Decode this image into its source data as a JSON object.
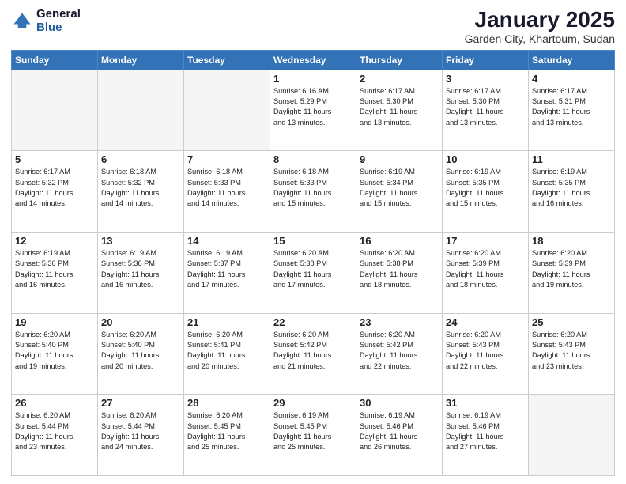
{
  "header": {
    "title": "January 2025",
    "subtitle": "Garden City, Khartoum, Sudan",
    "logo_general": "General",
    "logo_blue": "Blue"
  },
  "days_of_week": [
    "Sunday",
    "Monday",
    "Tuesday",
    "Wednesday",
    "Thursday",
    "Friday",
    "Saturday"
  ],
  "weeks": [
    [
      {
        "day": "",
        "info": ""
      },
      {
        "day": "",
        "info": ""
      },
      {
        "day": "",
        "info": ""
      },
      {
        "day": "1",
        "info": "Sunrise: 6:16 AM\nSunset: 5:29 PM\nDaylight: 11 hours\nand 13 minutes."
      },
      {
        "day": "2",
        "info": "Sunrise: 6:17 AM\nSunset: 5:30 PM\nDaylight: 11 hours\nand 13 minutes."
      },
      {
        "day": "3",
        "info": "Sunrise: 6:17 AM\nSunset: 5:30 PM\nDaylight: 11 hours\nand 13 minutes."
      },
      {
        "day": "4",
        "info": "Sunrise: 6:17 AM\nSunset: 5:31 PM\nDaylight: 11 hours\nand 13 minutes."
      }
    ],
    [
      {
        "day": "5",
        "info": "Sunrise: 6:17 AM\nSunset: 5:32 PM\nDaylight: 11 hours\nand 14 minutes."
      },
      {
        "day": "6",
        "info": "Sunrise: 6:18 AM\nSunset: 5:32 PM\nDaylight: 11 hours\nand 14 minutes."
      },
      {
        "day": "7",
        "info": "Sunrise: 6:18 AM\nSunset: 5:33 PM\nDaylight: 11 hours\nand 14 minutes."
      },
      {
        "day": "8",
        "info": "Sunrise: 6:18 AM\nSunset: 5:33 PM\nDaylight: 11 hours\nand 15 minutes."
      },
      {
        "day": "9",
        "info": "Sunrise: 6:19 AM\nSunset: 5:34 PM\nDaylight: 11 hours\nand 15 minutes."
      },
      {
        "day": "10",
        "info": "Sunrise: 6:19 AM\nSunset: 5:35 PM\nDaylight: 11 hours\nand 15 minutes."
      },
      {
        "day": "11",
        "info": "Sunrise: 6:19 AM\nSunset: 5:35 PM\nDaylight: 11 hours\nand 16 minutes."
      }
    ],
    [
      {
        "day": "12",
        "info": "Sunrise: 6:19 AM\nSunset: 5:36 PM\nDaylight: 11 hours\nand 16 minutes."
      },
      {
        "day": "13",
        "info": "Sunrise: 6:19 AM\nSunset: 5:36 PM\nDaylight: 11 hours\nand 16 minutes."
      },
      {
        "day": "14",
        "info": "Sunrise: 6:19 AM\nSunset: 5:37 PM\nDaylight: 11 hours\nand 17 minutes."
      },
      {
        "day": "15",
        "info": "Sunrise: 6:20 AM\nSunset: 5:38 PM\nDaylight: 11 hours\nand 17 minutes."
      },
      {
        "day": "16",
        "info": "Sunrise: 6:20 AM\nSunset: 5:38 PM\nDaylight: 11 hours\nand 18 minutes."
      },
      {
        "day": "17",
        "info": "Sunrise: 6:20 AM\nSunset: 5:39 PM\nDaylight: 11 hours\nand 18 minutes."
      },
      {
        "day": "18",
        "info": "Sunrise: 6:20 AM\nSunset: 5:39 PM\nDaylight: 11 hours\nand 19 minutes."
      }
    ],
    [
      {
        "day": "19",
        "info": "Sunrise: 6:20 AM\nSunset: 5:40 PM\nDaylight: 11 hours\nand 19 minutes."
      },
      {
        "day": "20",
        "info": "Sunrise: 6:20 AM\nSunset: 5:40 PM\nDaylight: 11 hours\nand 20 minutes."
      },
      {
        "day": "21",
        "info": "Sunrise: 6:20 AM\nSunset: 5:41 PM\nDaylight: 11 hours\nand 20 minutes."
      },
      {
        "day": "22",
        "info": "Sunrise: 6:20 AM\nSunset: 5:42 PM\nDaylight: 11 hours\nand 21 minutes."
      },
      {
        "day": "23",
        "info": "Sunrise: 6:20 AM\nSunset: 5:42 PM\nDaylight: 11 hours\nand 22 minutes."
      },
      {
        "day": "24",
        "info": "Sunrise: 6:20 AM\nSunset: 5:43 PM\nDaylight: 11 hours\nand 22 minutes."
      },
      {
        "day": "25",
        "info": "Sunrise: 6:20 AM\nSunset: 5:43 PM\nDaylight: 11 hours\nand 23 minutes."
      }
    ],
    [
      {
        "day": "26",
        "info": "Sunrise: 6:20 AM\nSunset: 5:44 PM\nDaylight: 11 hours\nand 23 minutes."
      },
      {
        "day": "27",
        "info": "Sunrise: 6:20 AM\nSunset: 5:44 PM\nDaylight: 11 hours\nand 24 minutes."
      },
      {
        "day": "28",
        "info": "Sunrise: 6:20 AM\nSunset: 5:45 PM\nDaylight: 11 hours\nand 25 minutes."
      },
      {
        "day": "29",
        "info": "Sunrise: 6:19 AM\nSunset: 5:45 PM\nDaylight: 11 hours\nand 25 minutes."
      },
      {
        "day": "30",
        "info": "Sunrise: 6:19 AM\nSunset: 5:46 PM\nDaylight: 11 hours\nand 26 minutes."
      },
      {
        "day": "31",
        "info": "Sunrise: 6:19 AM\nSunset: 5:46 PM\nDaylight: 11 hours\nand 27 minutes."
      },
      {
        "day": "",
        "info": ""
      }
    ]
  ]
}
